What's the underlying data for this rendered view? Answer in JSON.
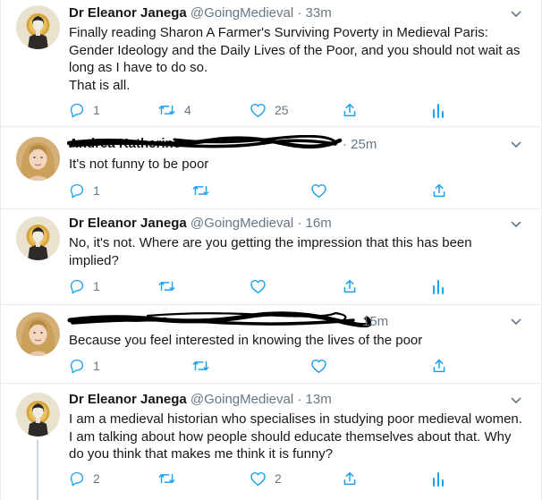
{
  "tweets": [
    {
      "author": "Dr Eleanor Janega",
      "handle": "@GoingMedieval",
      "separator": "·",
      "time": "33m",
      "lines": [
        "Finally reading Sharon A Farmer's Surviving Poverty in Medieval Paris:",
        "Gender Ideology and the Daily Lives of the Poor, and you should not wait as",
        "long as I have to do so.",
        "That is all."
      ],
      "replies": "1",
      "retweets": "4",
      "likes": "25",
      "avatar": "historian-avatar"
    },
    {
      "author": "Andrea Katherine",
      "author_redacted": true,
      "separator": "·",
      "time": "25m",
      "lines": [
        "It's not funny to be poor"
      ],
      "replies": "1",
      "retweets": "",
      "likes": "",
      "avatar": "blonde-woman-avatar"
    },
    {
      "author": "Dr Eleanor Janega",
      "handle": "@GoingMedieval",
      "separator": "·",
      "time": "16m",
      "lines": [
        "No, it's not. Where are you getting the impression that this has been",
        "implied?"
      ],
      "replies": "1",
      "retweets": "",
      "likes": "",
      "avatar": "historian-avatar"
    },
    {
      "author_redacted": true,
      "time": "15m",
      "lines": [
        "Because you feel interested in knowing the lives of the poor"
      ],
      "replies": "1",
      "retweets": "",
      "likes": "",
      "avatar": "blonde-woman-avatar"
    },
    {
      "author": "Dr Eleanor Janega",
      "handle": "@GoingMedieval",
      "separator": "·",
      "time": "13m",
      "lines": [
        "I am a medieval historian who specialises in studying poor medieval women.",
        "I am talking about how people should educate themselves about that. Why",
        "do you think that makes me think it is funny?"
      ],
      "replies": "2",
      "retweets": "",
      "likes": "2",
      "avatar": "historian-avatar"
    }
  ],
  "colors": {
    "text": "#14171a",
    "secondary": "#657786",
    "icon": "#1da1f2",
    "divider": "#e6ecf0",
    "thread_line": "#ccd6dd",
    "redaction": "#000000"
  },
  "icons": {
    "reply": "reply-icon",
    "retweet": "retweet-icon",
    "like": "heart-icon",
    "share": "share-icon",
    "analytics": "analytics-icon",
    "more": "chevron-down-icon"
  }
}
